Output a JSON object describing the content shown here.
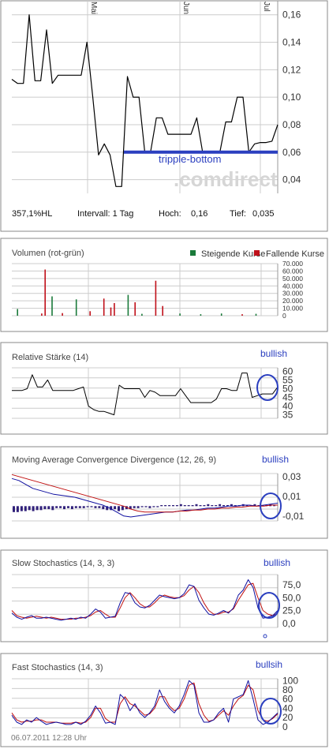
{
  "chart_data": [
    {
      "type": "line",
      "title": "",
      "x_ticks": [
        "Mai",
        "Jun",
        "Jul"
      ],
      "y_ticks": [
        "0,16",
        "0,14",
        "0,12",
        "0,10",
        "0,08",
        "0,06",
        "0,04"
      ],
      "ylim": [
        0.03,
        0.165
      ],
      "series": [
        {
          "values": [
            0.113,
            0.11,
            0.11,
            0.16,
            0.112,
            0.112,
            0.149,
            0.11,
            0.116,
            0.116,
            0.116,
            0.116,
            0.116,
            0.14,
            0.1,
            0.058,
            0.066,
            0.058,
            0.035,
            0.035,
            0.115,
            0.1,
            0.1,
            0.06,
            0.06,
            0.085,
            0.085,
            0.073,
            0.073,
            0.073,
            0.073,
            0.073,
            0.085,
            0.06,
            0.06,
            0.06,
            0.06,
            0.082,
            0.082,
            0.1,
            0.1,
            0.06,
            0.066,
            0.067,
            0.067,
            0.068,
            0.08
          ]
        }
      ],
      "support_line": 0.06,
      "annotation": "tripple-bottom",
      "watermark": ".comdirect",
      "stats": {
        "hl": "357,1%HL",
        "interval": "Intervall: 1 Tag",
        "high_label": "Hoch:",
        "high": "0,16",
        "low_label": "Tief:",
        "low": "0,035"
      }
    },
    {
      "type": "bar",
      "title": "Volumen (rot-grün)",
      "legend": [
        {
          "name": "Steigende Kurse",
          "color": "#1a7a3a"
        },
        {
          "name": "Fallende Kurse",
          "color": "#c0101a"
        }
      ],
      "y_ticks": [
        "70.000",
        "60.000",
        "50.000",
        "40.000",
        "30.000",
        "20.000",
        "10.000",
        "0"
      ],
      "ylim": [
        0,
        70000
      ],
      "bars": [
        {
          "i": 1,
          "v": 9000,
          "c": "g"
        },
        {
          "i": 8,
          "v": 3000,
          "c": "r"
        },
        {
          "i": 9,
          "v": 62000,
          "c": "r"
        },
        {
          "i": 11,
          "v": 26000,
          "c": "g"
        },
        {
          "i": 14,
          "v": 3500,
          "c": "r"
        },
        {
          "i": 18,
          "v": 22000,
          "c": "g"
        },
        {
          "i": 22,
          "v": 6000,
          "c": "r"
        },
        {
          "i": 26,
          "v": 23000,
          "c": "r"
        },
        {
          "i": 28,
          "v": 11000,
          "c": "r"
        },
        {
          "i": 29,
          "v": 17000,
          "c": "r"
        },
        {
          "i": 33,
          "v": 28000,
          "c": "g"
        },
        {
          "i": 35,
          "v": 18000,
          "c": "r"
        },
        {
          "i": 37,
          "v": 2500,
          "c": "g"
        },
        {
          "i": 41,
          "v": 47000,
          "c": "r"
        },
        {
          "i": 43,
          "v": 13000,
          "c": "r"
        },
        {
          "i": 48,
          "v": 3000,
          "c": "g"
        },
        {
          "i": 54,
          "v": 2000,
          "c": "g"
        },
        {
          "i": 60,
          "v": 3000,
          "c": "g"
        },
        {
          "i": 66,
          "v": 2000,
          "c": "r"
        },
        {
          "i": 70,
          "v": 2500,
          "c": "g"
        }
      ]
    },
    {
      "type": "line",
      "title": "Relative Stärke (14)",
      "annotation": "bullish",
      "y_ticks": [
        "60",
        "55",
        "50",
        "45",
        "40",
        "35"
      ],
      "ylim": [
        33,
        62
      ],
      "series": [
        {
          "values": [
            49,
            49,
            49,
            50,
            58,
            51,
            51,
            55,
            49,
            49,
            49,
            49,
            49,
            50,
            51,
            40,
            38,
            37,
            37,
            36,
            35,
            52,
            50,
            50,
            50,
            50,
            45,
            49,
            48,
            46,
            46,
            46,
            46,
            50,
            46,
            42,
            42,
            42,
            42,
            42,
            44,
            50,
            50,
            49,
            49,
            59,
            59,
            45,
            46,
            47,
            47,
            47,
            51
          ]
        }
      ]
    },
    {
      "type": "line",
      "title": "Moving Average Convergence Divergence (12, 26, 9)",
      "annotation": "bullish",
      "y_ticks": [
        "0,03",
        "0,01",
        "-0,01"
      ],
      "ylim": [
        -0.015,
        0.033
      ],
      "series": [
        {
          "values": [
            0.028,
            0.026,
            0.022,
            0.018,
            0.016,
            0.014,
            0.012,
            0.011,
            0.01,
            0.009,
            0.007,
            0.005,
            0.003,
            0.001,
            -0.002,
            -0.006,
            -0.01,
            -0.011,
            -0.01,
            -0.009,
            -0.008,
            -0.007,
            -0.006,
            -0.006,
            -0.005,
            -0.004,
            -0.004,
            -0.003,
            -0.002,
            -0.002,
            -0.001,
            0.0,
            0.0,
            0.001,
            0.001,
            0.0,
            0.001,
            0.002,
            0.003
          ]
        },
        {
          "values": [
            0.032,
            0.03,
            0.028,
            0.026,
            0.024,
            0.022,
            0.02,
            0.018,
            0.016,
            0.014,
            0.012,
            0.01,
            0.008,
            0.006,
            0.004,
            0.002,
            0.0,
            -0.003,
            -0.005,
            -0.006,
            -0.006,
            -0.006,
            -0.006,
            -0.006,
            -0.005,
            -0.005,
            -0.004,
            -0.004,
            -0.003,
            -0.003,
            -0.002,
            -0.002,
            -0.001,
            -0.001,
            0.0,
            0.0,
            0.0,
            0.001,
            0.001
          ]
        }
      ],
      "histogram": [
        -0.006,
        -0.006,
        -0.005,
        -0.005,
        -0.004,
        -0.005,
        -0.004,
        -0.004,
        -0.003,
        -0.003,
        -0.004,
        -0.002,
        -0.002,
        -0.003,
        -0.002,
        -0.003,
        -0.002,
        -0.002,
        -0.002,
        -0.001,
        -0.001,
        -0.002,
        -0.002,
        -0.003,
        -0.004,
        -0.004,
        -0.003,
        -0.005,
        -0.004,
        -0.003,
        -0.003,
        -0.002,
        -0.002,
        -0.001,
        -0.001,
        -0.002,
        -0.001,
        -0.001,
        0.001,
        0.001,
        0.001,
        0.001,
        0.001,
        0.002,
        0.001,
        0.001,
        0.001,
        0.002,
        0.001,
        0.001,
        0.002,
        0.001,
        0.001,
        0.002,
        0.001,
        0.001,
        0.002,
        0.001,
        0.001,
        0.002,
        0.001,
        0.001,
        0.002,
        0.001,
        0.001,
        0.001,
        0.002,
        0.001
      ]
    },
    {
      "type": "line",
      "title": "Slow Stochastics (14, 3, 3)",
      "annotation": "bullish",
      "y_ticks": [
        "75,0",
        "50,0",
        "25,0",
        "0,0"
      ],
      "ylim": [
        -8,
        95
      ],
      "series": [
        {
          "values": [
            20,
            12,
            8,
            12,
            15,
            10,
            10,
            12,
            10,
            8,
            6,
            8,
            10,
            8,
            12,
            10,
            18,
            28,
            22,
            10,
            12,
            14,
            40,
            60,
            58,
            40,
            32,
            30,
            35,
            45,
            55,
            52,
            50,
            48,
            50,
            58,
            75,
            72,
            45,
            30,
            18,
            16,
            20,
            25,
            20,
            30,
            55,
            65,
            85,
            70,
            30,
            10,
            12,
            15,
            25
          ]
        },
        {
          "values": [
            25,
            15,
            12,
            10,
            12,
            14,
            12,
            10,
            12,
            10,
            8,
            8,
            8,
            10,
            10,
            12,
            15,
            22,
            25,
            18,
            12,
            12,
            30,
            50,
            60,
            50,
            38,
            32,
            32,
            40,
            50,
            55,
            52,
            50,
            50,
            54,
            65,
            72,
            60,
            40,
            25,
            18,
            18,
            22,
            22,
            28,
            45,
            60,
            75,
            78,
            50,
            25,
            18,
            15,
            20
          ]
        }
      ]
    },
    {
      "type": "line",
      "title": "Fast Stochastics (14, 3)",
      "annotation": "bullsih",
      "y_ticks": [
        "100",
        "80",
        "60",
        "40",
        "20",
        "0"
      ],
      "ylim": [
        -2,
        104
      ],
      "series": [
        {
          "values": [
            25,
            10,
            5,
            15,
            10,
            20,
            12,
            5,
            8,
            10,
            8,
            5,
            5,
            10,
            5,
            12,
            25,
            45,
            30,
            8,
            10,
            5,
            70,
            60,
            35,
            50,
            30,
            20,
            30,
            45,
            80,
            55,
            40,
            30,
            45,
            70,
            100,
            90,
            30,
            10,
            10,
            15,
            30,
            40,
            10,
            60,
            65,
            70,
            100,
            60,
            15,
            5,
            10,
            20,
            30
          ]
        },
        {
          "values": [
            30,
            15,
            10,
            12,
            12,
            15,
            15,
            10,
            10,
            10,
            8,
            8,
            8,
            10,
            8,
            10,
            20,
            40,
            40,
            18,
            10,
            10,
            50,
            65,
            50,
            45,
            35,
            25,
            28,
            40,
            65,
            65,
            45,
            35,
            40,
            60,
            90,
            95,
            50,
            25,
            12,
            15,
            25,
            35,
            25,
            45,
            60,
            68,
            90,
            80,
            35,
            15,
            12,
            18,
            28
          ]
        }
      ]
    }
  ],
  "footer": "06.07.2011 12:28 Uhr",
  "colors": {
    "price": "#000000",
    "annotation": "#2b3fbf",
    "frame": "#888888",
    "grid": "#cccccc",
    "series_blue": "#1010a0",
    "series_red": "#c01010",
    "bull": "#1a7a3a",
    "bear": "#c0101a"
  }
}
